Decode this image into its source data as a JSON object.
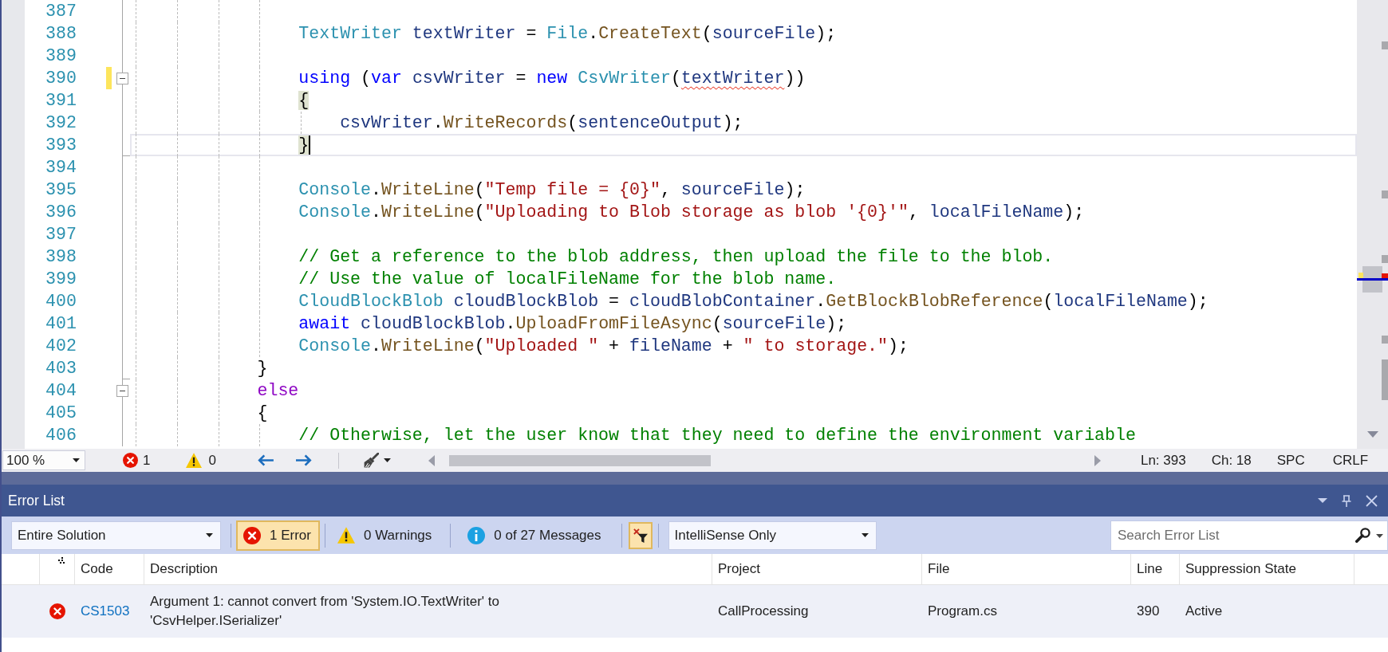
{
  "editor": {
    "lines": [
      {
        "number": "387",
        "changed": false,
        "current": false
      },
      {
        "number": "388",
        "changed": false,
        "current": false,
        "tokens": [
          {
            "text": "                TextWriter",
            "kind": "type"
          },
          {
            "text": " textWriter",
            "kind": "local"
          },
          {
            "text": " = ",
            "kind": "plain"
          },
          {
            "text": "File",
            "kind": "type"
          },
          {
            "text": ".",
            "kind": "plain"
          },
          {
            "text": "CreateText",
            "kind": "method"
          },
          {
            "text": "(",
            "kind": "plain"
          },
          {
            "text": "sourceFile",
            "kind": "local"
          },
          {
            "text": ");",
            "kind": "plain"
          }
        ]
      },
      {
        "number": "389",
        "changed": false,
        "current": false
      },
      {
        "number": "390",
        "changed": true,
        "current": false,
        "expanded": true,
        "tokens": [
          {
            "text": "                using",
            "kind": "keyword"
          },
          {
            "text": " (",
            "kind": "plain"
          },
          {
            "text": "var",
            "kind": "keyword"
          },
          {
            "text": " csvWriter",
            "kind": "local"
          },
          {
            "text": " = ",
            "kind": "plain"
          },
          {
            "text": "new",
            "kind": "keyword"
          },
          {
            "text": " CsvWriter",
            "kind": "type"
          },
          {
            "text": "(",
            "kind": "plain"
          },
          {
            "text": "textWriter",
            "kind": "local",
            "error": true
          },
          {
            "text": "))",
            "kind": "plain"
          }
        ]
      },
      {
        "number": "391",
        "changed": false,
        "current": false,
        "tokens": [
          {
            "text": "                {",
            "kind": "plain",
            "match": true
          }
        ]
      },
      {
        "number": "392",
        "changed": false,
        "current": false,
        "tokens": [
          {
            "text": "                    csvWriter",
            "kind": "local"
          },
          {
            "text": ".",
            "kind": "plain"
          },
          {
            "text": "WriteRecords",
            "kind": "method"
          },
          {
            "text": "(",
            "kind": "plain"
          },
          {
            "text": "sentenceOutput",
            "kind": "local"
          },
          {
            "text": ");",
            "kind": "plain"
          }
        ]
      },
      {
        "number": "393",
        "changed": false,
        "current": true,
        "block_end": true,
        "tokens": [
          {
            "text": "                }",
            "kind": "plain",
            "match": true
          }
        ]
      },
      {
        "number": "394",
        "changed": false,
        "current": false
      },
      {
        "number": "395",
        "changed": false,
        "current": false,
        "tokens": [
          {
            "text": "                Console",
            "kind": "type"
          },
          {
            "text": ".",
            "kind": "plain"
          },
          {
            "text": "WriteLine",
            "kind": "method"
          },
          {
            "text": "(",
            "kind": "plain"
          },
          {
            "text": "\"Temp file = {0}\"",
            "kind": "string"
          },
          {
            "text": ", ",
            "kind": "plain"
          },
          {
            "text": "sourceFile",
            "kind": "local"
          },
          {
            "text": ");",
            "kind": "plain"
          }
        ]
      },
      {
        "number": "396",
        "changed": false,
        "current": false,
        "tokens": [
          {
            "text": "                Console",
            "kind": "type"
          },
          {
            "text": ".",
            "kind": "plain"
          },
          {
            "text": "WriteLine",
            "kind": "method"
          },
          {
            "text": "(",
            "kind": "plain"
          },
          {
            "text": "\"Uploading to Blob storage as blob '{0}'\"",
            "kind": "string"
          },
          {
            "text": ", ",
            "kind": "plain"
          },
          {
            "text": "localFileName",
            "kind": "local"
          },
          {
            "text": ");",
            "kind": "plain"
          }
        ]
      },
      {
        "number": "397",
        "changed": false,
        "current": false
      },
      {
        "number": "398",
        "changed": false,
        "current": false,
        "tokens": [
          {
            "text": "                // Get a reference to the blob address, then upload the file to the blob.",
            "kind": "comment"
          }
        ]
      },
      {
        "number": "399",
        "changed": false,
        "current": false,
        "tokens": [
          {
            "text": "                // Use the value of localFileName for the blob name.",
            "kind": "comment"
          }
        ]
      },
      {
        "number": "400",
        "changed": false,
        "current": false,
        "tokens": [
          {
            "text": "                CloudBlockBlob",
            "kind": "type"
          },
          {
            "text": " cloudBlockBlob",
            "kind": "local"
          },
          {
            "text": " = ",
            "kind": "plain"
          },
          {
            "text": "cloudBlobContainer",
            "kind": "local"
          },
          {
            "text": ".",
            "kind": "plain"
          },
          {
            "text": "GetBlockBlobReference",
            "kind": "method"
          },
          {
            "text": "(",
            "kind": "plain"
          },
          {
            "text": "localFileName",
            "kind": "local"
          },
          {
            "text": ");",
            "kind": "plain"
          }
        ]
      },
      {
        "number": "401",
        "changed": false,
        "current": false,
        "tokens": [
          {
            "text": "                await",
            "kind": "keyword"
          },
          {
            "text": " cloudBlockBlob",
            "kind": "local"
          },
          {
            "text": ".",
            "kind": "plain"
          },
          {
            "text": "UploadFromFileAsync",
            "kind": "method"
          },
          {
            "text": "(",
            "kind": "plain"
          },
          {
            "text": "sourceFile",
            "kind": "local"
          },
          {
            "text": ");",
            "kind": "plain"
          }
        ]
      },
      {
        "number": "402",
        "changed": false,
        "current": false,
        "tokens": [
          {
            "text": "                Console",
            "kind": "type"
          },
          {
            "text": ".",
            "kind": "plain"
          },
          {
            "text": "WriteLine",
            "kind": "method"
          },
          {
            "text": "(",
            "kind": "plain"
          },
          {
            "text": "\"Uploaded \"",
            "kind": "string"
          },
          {
            "text": " + ",
            "kind": "plain"
          },
          {
            "text": "fileName",
            "kind": "local"
          },
          {
            "text": " + ",
            "kind": "plain"
          },
          {
            "text": "\" to storage.\"",
            "kind": "string"
          },
          {
            "text": ");",
            "kind": "plain"
          }
        ]
      },
      {
        "number": "403",
        "changed": false,
        "current": false,
        "block_end": true,
        "tokens": [
          {
            "text": "            }",
            "kind": "plain"
          }
        ]
      },
      {
        "number": "404",
        "changed": false,
        "current": false,
        "expanded": true,
        "tokens": [
          {
            "text": "            else",
            "kind": "control"
          }
        ]
      },
      {
        "number": "405",
        "changed": false,
        "current": false,
        "tokens": [
          {
            "text": "            {",
            "kind": "plain"
          }
        ]
      },
      {
        "number": "406",
        "changed": false,
        "current": false,
        "tokens": [
          {
            "text": "                // Otherwise, let the user know that they need to define the environment variable",
            "kind": "comment"
          }
        ]
      }
    ]
  },
  "status_bar": {
    "zoom": "100 %",
    "error_count": "1",
    "warning_count": "0",
    "line_position": "Ln: 393",
    "char_position": "Ch: 18",
    "indentation": "SPC",
    "line_ending": "CRLF"
  },
  "error_list": {
    "title": "Error List",
    "scope": "Entire Solution",
    "filters": [
      {
        "kind": "error",
        "label": "1 Error",
        "on": true
      },
      {
        "kind": "warning",
        "label": "0 Warnings",
        "on": false
      },
      {
        "kind": "info",
        "label": "0 of 27 Messages",
        "on": false
      }
    ],
    "filter_button": {
      "on": true
    },
    "source": "IntelliSense Only",
    "search": {
      "placeholder": "Search Error List"
    },
    "columns": [
      "Code",
      "Description",
      "Project",
      "File",
      "Line",
      "Suppression State"
    ],
    "rows": [
      {
        "kind": "error",
        "selected": true,
        "code": "CS1503",
        "description": "Argument 1: cannot convert from 'System.IO.TextWriter' to 'CsvHelper.ISerializer'",
        "project": "CallProcessing",
        "file": "Program.cs",
        "line": "390",
        "suppression_state": "Active"
      }
    ]
  }
}
